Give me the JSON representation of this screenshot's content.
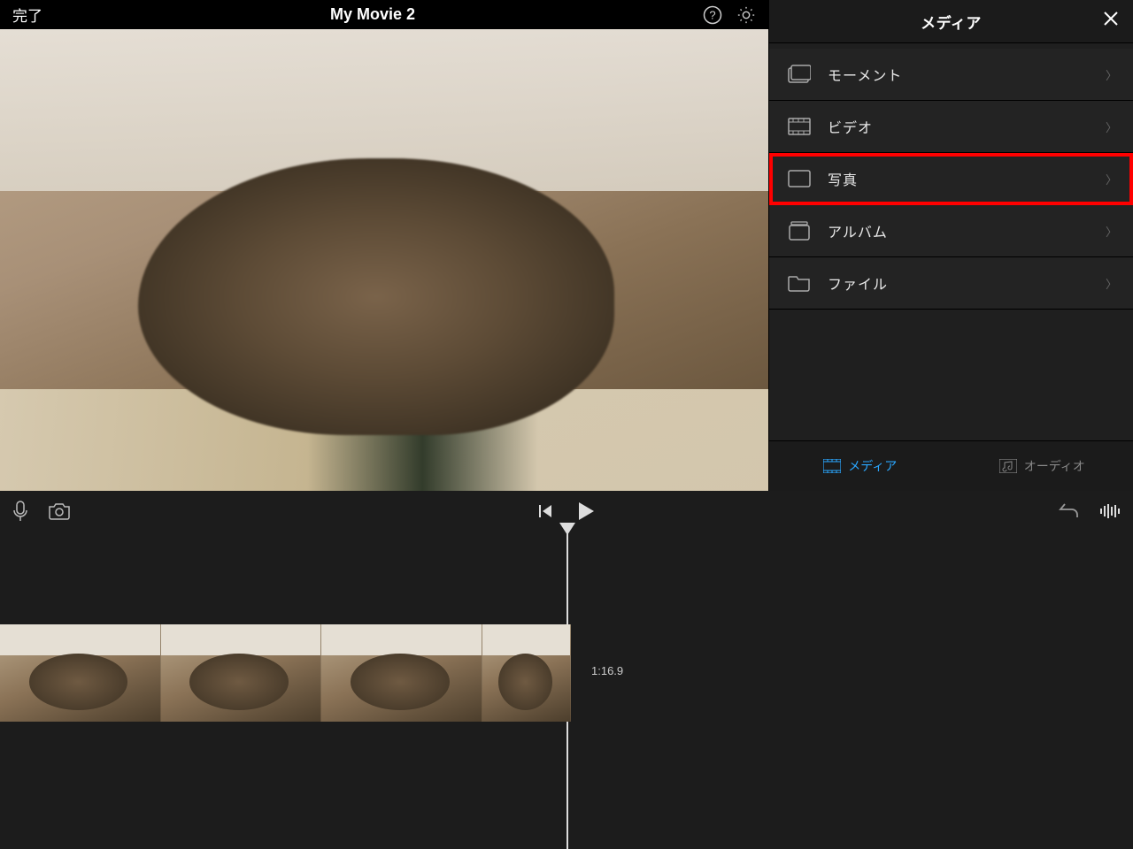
{
  "header": {
    "done": "完了",
    "title": "My Movie 2"
  },
  "sidebar": {
    "title": "メディア",
    "items": [
      {
        "label": "モーメント",
        "icon": "moments",
        "highlight": false
      },
      {
        "label": "ビデオ",
        "icon": "video",
        "highlight": false
      },
      {
        "label": "写真",
        "icon": "photo",
        "highlight": true
      },
      {
        "label": "アルバム",
        "icon": "albums",
        "highlight": false
      },
      {
        "label": "ファイル",
        "icon": "files",
        "highlight": false
      }
    ],
    "tabs": {
      "media": "メディア",
      "audio": "オーディオ"
    }
  },
  "timeline": {
    "timecode": "1:16.9"
  }
}
